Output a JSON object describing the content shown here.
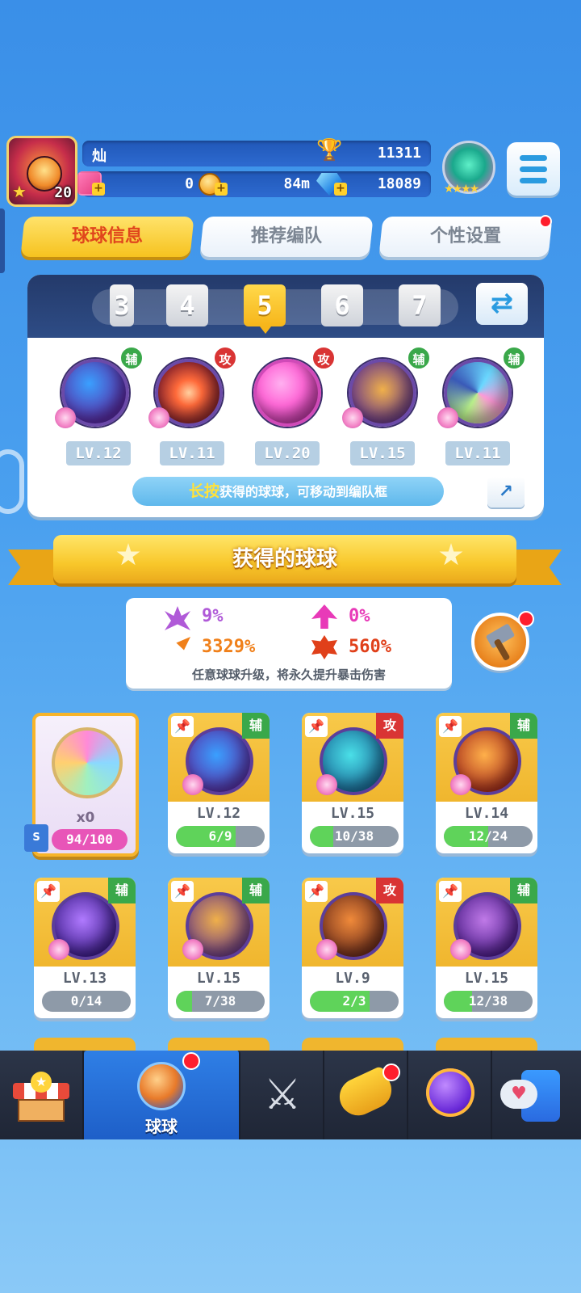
{
  "player": {
    "name": "灿",
    "level": "20",
    "trophies": "11311",
    "shards": "0",
    "coins": "84m",
    "gems": "18089"
  },
  "tabs": [
    {
      "label": "球球信息",
      "active": true
    },
    {
      "label": "推荐编队",
      "active": false
    },
    {
      "label": "个性设置",
      "active": false,
      "badge": true
    }
  ],
  "team": {
    "numbers": [
      "3",
      "4",
      "5",
      "6",
      "7"
    ],
    "selected": "5",
    "balls": [
      {
        "level": "LV.12",
        "type": "辅",
        "colors": [
          "#3aa0ff",
          "#5a2ea8"
        ]
      },
      {
        "level": "LV.11",
        "type": "攻",
        "colors": [
          "#ff6a3a",
          "#7a1a2a"
        ]
      },
      {
        "level": "LV.20",
        "type": "攻",
        "colors": [
          "#ff6ad8",
          "#b02a98"
        ]
      },
      {
        "level": "LV.15",
        "type": "辅",
        "colors": [
          "#f0b04a",
          "#6a3a8a"
        ]
      },
      {
        "level": "LV.11",
        "type": "辅",
        "colors": [
          "#6ad8ff",
          "#3a5ab8"
        ]
      }
    ],
    "hint_highlight": "长按",
    "hint_text": "获得的球球，可移动到编队框"
  },
  "banner": {
    "title": "获得的球球"
  },
  "stats": {
    "values": [
      "9%",
      "0%",
      "3329%",
      "560%"
    ],
    "note": "任意球球升级，将永久提升暴击伤害",
    "colors": [
      "#b05ad8",
      "#e83ab8",
      "#f0801a",
      "#e0401a"
    ]
  },
  "special": {
    "count": "x0",
    "progress": "94/100",
    "puzzle": "S"
  },
  "cards": [
    {
      "level": "LV.12",
      "progress": "6/9",
      "fill": 0.67,
      "type": "辅",
      "colors": [
        "#3aa0ff",
        "#5a2ea8"
      ]
    },
    {
      "level": "LV.15",
      "progress": "10/38",
      "fill": 0.26,
      "type": "攻",
      "colors": [
        "#4ae0e8",
        "#1a6a9a"
      ]
    },
    {
      "level": "LV.14",
      "progress": "12/24",
      "fill": 0.5,
      "type": "辅",
      "colors": [
        "#ffb04a",
        "#a82a1a"
      ]
    },
    {
      "level": "LV.13",
      "progress": "0/14",
      "fill": 0.0,
      "type": "辅",
      "colors": [
        "#b07aff",
        "#3a1a8a"
      ]
    },
    {
      "level": "LV.15",
      "progress": "7/38",
      "fill": 0.18,
      "type": "辅",
      "colors": [
        "#f0b04a",
        "#6a3a8a"
      ]
    },
    {
      "level": "LV.9",
      "progress": "2/3",
      "fill": 0.67,
      "type": "攻",
      "colors": [
        "#f08a3a",
        "#6a2a1a"
      ]
    },
    {
      "level": "LV.15",
      "progress": "12/38",
      "fill": 0.32,
      "type": "辅",
      "colors": [
        "#c07ae8",
        "#4a1a8a"
      ]
    }
  ],
  "nav": [
    {
      "icon": "shop-icon"
    },
    {
      "icon": "balls-icon",
      "label": "球球",
      "active": true,
      "badge": true
    },
    {
      "icon": "swords-icon"
    },
    {
      "icon": "whistle-icon",
      "badge": true
    },
    {
      "icon": "planet-icon"
    },
    {
      "icon": "chat-heart-icon"
    }
  ]
}
